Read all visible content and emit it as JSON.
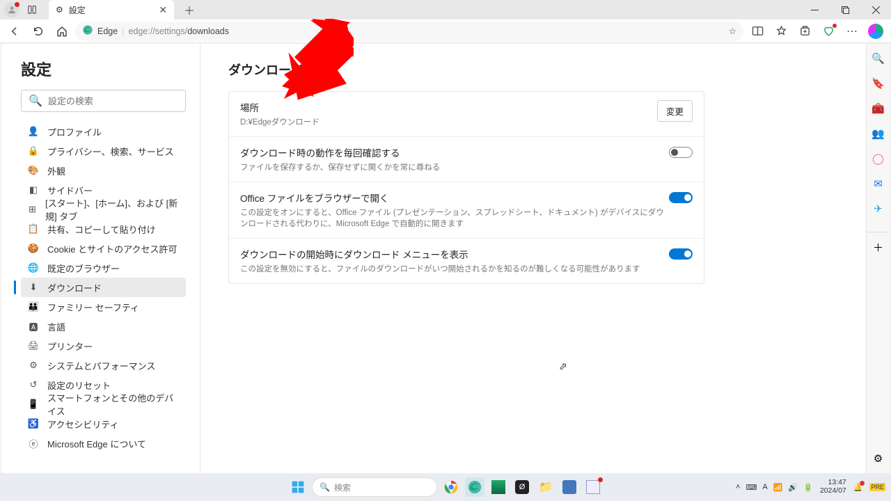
{
  "tab": {
    "title": "設定"
  },
  "url": {
    "edge_label": "Edge",
    "prefix": "edge://settings/",
    "path": "downloads"
  },
  "sidebar": {
    "title": "設定",
    "search_placeholder": "設定の検索",
    "items": [
      {
        "label": "プロファイル"
      },
      {
        "label": "プライバシー、検索、サービス"
      },
      {
        "label": "外観"
      },
      {
        "label": "サイドバー"
      },
      {
        "label": "[スタート]、[ホーム]、および [新規] タブ"
      },
      {
        "label": "共有、コピーして貼り付け"
      },
      {
        "label": "Cookie とサイトのアクセス許可"
      },
      {
        "label": "既定のブラウザー"
      },
      {
        "label": "ダウンロード"
      },
      {
        "label": "ファミリー セーフティ"
      },
      {
        "label": "言語"
      },
      {
        "label": "プリンター"
      },
      {
        "label": "システムとパフォーマンス"
      },
      {
        "label": "設定のリセット"
      },
      {
        "label": "スマートフォンとその他のデバイス"
      },
      {
        "label": "アクセシビリティ"
      },
      {
        "label": "Microsoft Edge について"
      }
    ]
  },
  "page": {
    "heading": "ダウンロード",
    "location": {
      "title": "場所",
      "value": "D:¥Edgeダウンロード",
      "button": "変更"
    },
    "opt1": {
      "title": "ダウンロード時の動作を毎回確認する",
      "sub": "ファイルを保存するか、保存せずに開くかを常に尋ねる"
    },
    "opt2": {
      "title": "Office ファイルをブラウザーで開く",
      "sub": "この設定をオンにすると、Office ファイル (プレゼンテーション、スプレッドシート、ドキュメント) がデバイスにダウンロードされる代わりに、Microsoft Edge で自動的に開きます"
    },
    "opt3": {
      "title": "ダウンロードの開始時にダウンロード メニューを表示",
      "sub": "この設定を無効にすると、ファイルのダウンロードがいつ開始されるかを知るのが難しくなる可能性があります"
    }
  },
  "taskbar": {
    "search_placeholder": "検索",
    "time": "13:47",
    "date": "2024/07"
  }
}
